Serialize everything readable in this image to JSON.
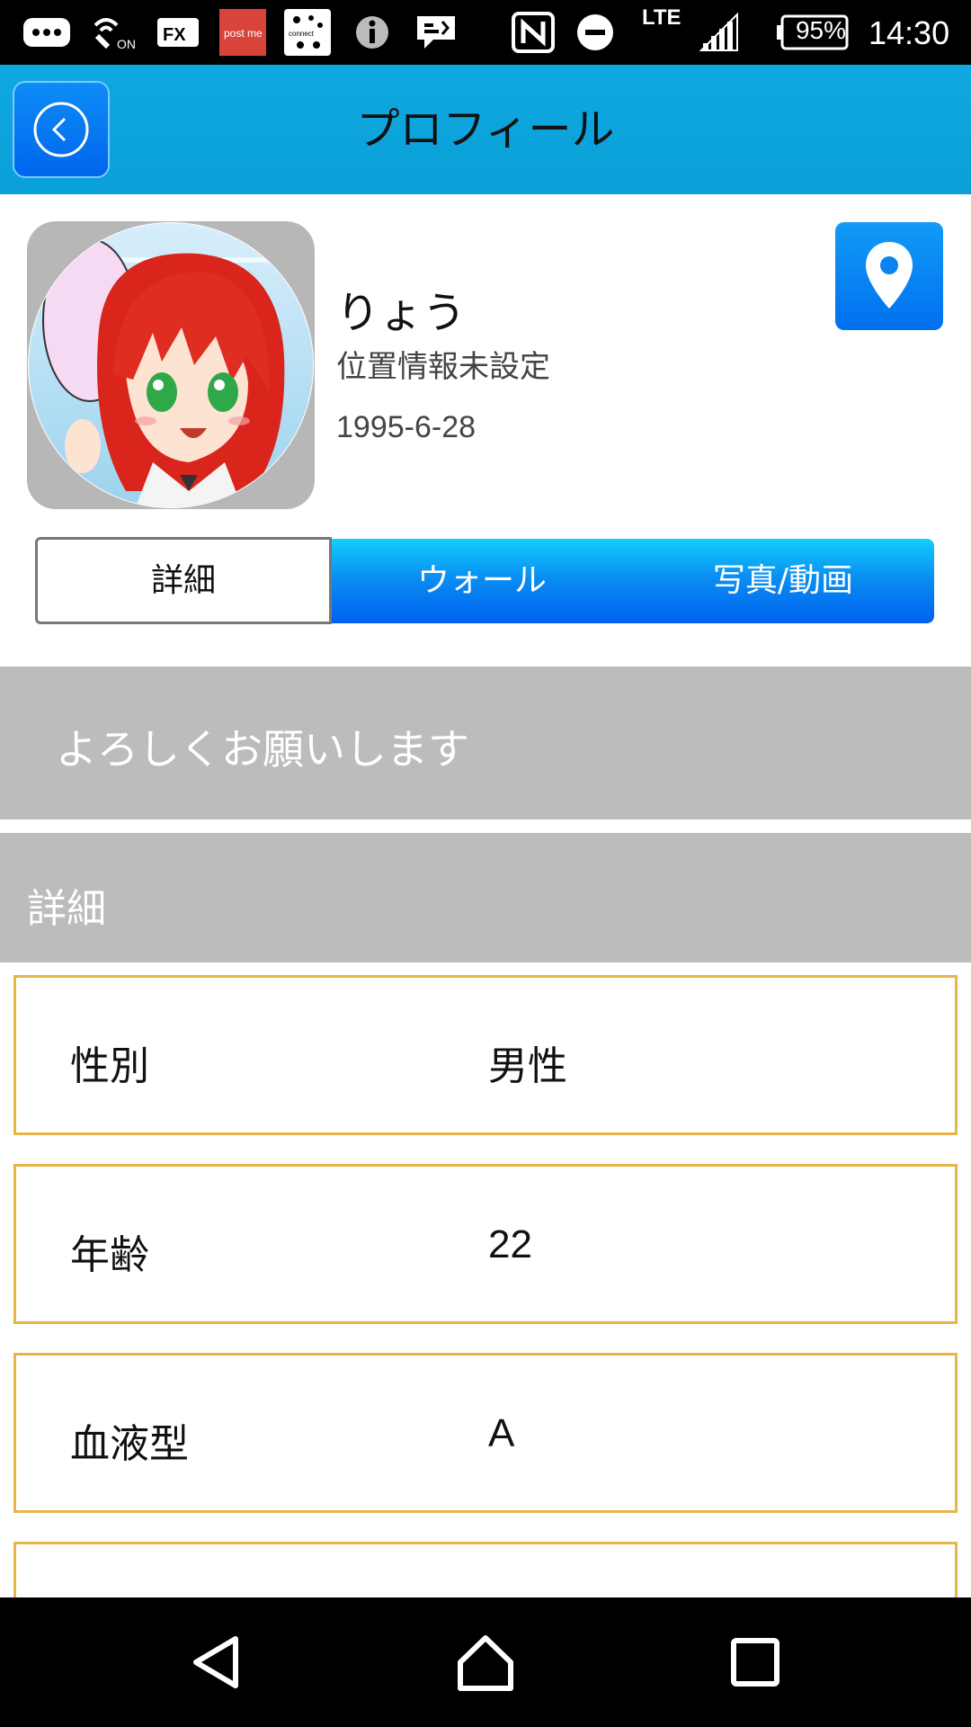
{
  "status_bar": {
    "icons": [
      "more-icon",
      "wifi-calling-icon",
      "fx-app-icon",
      "postme-app-icon",
      "connect-app-icon",
      "info-icon",
      "message-icon",
      "nfc-icon",
      "do-not-disturb-icon",
      "signal-icon",
      "battery-icon"
    ],
    "postme_label": "post me",
    "connect_label": "connect",
    "fx_label": "FX",
    "wifi_on_label": "ON",
    "network": "LTE",
    "battery": "95%",
    "time": "14:30"
  },
  "header": {
    "title": "プロフィール",
    "back_icon": "chevron-left-circle-icon"
  },
  "profile": {
    "name": "りょう",
    "location": "位置情報未設定",
    "birthdate": "1995-6-28",
    "map_icon": "map-pin-icon"
  },
  "tabs": [
    {
      "label": "詳細",
      "active": true
    },
    {
      "label": "ウォール",
      "active": false
    },
    {
      "label": "写真/動画",
      "active": false
    }
  ],
  "greeting": "よろしくお願いします",
  "details": {
    "header": "詳細",
    "rows": [
      {
        "label": "性別",
        "value": "男性"
      },
      {
        "label": "年齢",
        "value": "22"
      },
      {
        "label": "血液型",
        "value": "A"
      },
      {
        "label": "",
        "value": ""
      }
    ]
  },
  "nav_bar": {
    "icons": [
      "back-triangle-icon",
      "home-icon",
      "recents-icon"
    ]
  },
  "colors": {
    "header_bg": "#0a9fd8",
    "button_blue": "#0070ee",
    "tab_gradient_top": "#12d0fb",
    "section_gray": "#bcbcbc",
    "row_border": "#e8b648"
  }
}
